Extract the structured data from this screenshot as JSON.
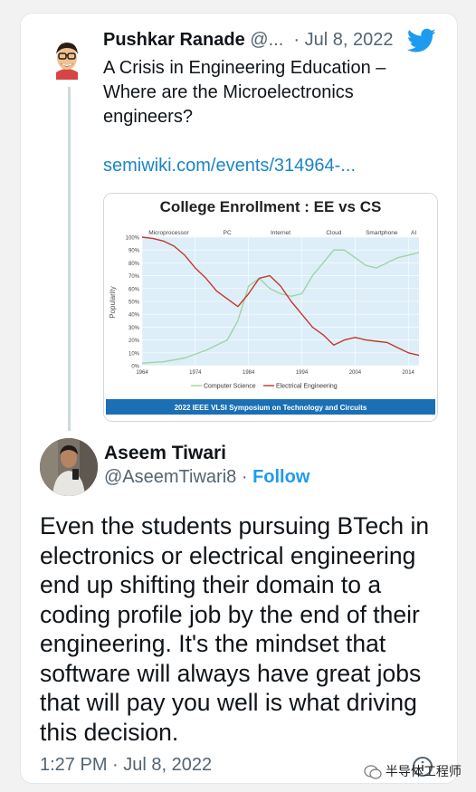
{
  "quoted_tweet": {
    "author_name": "Pushkar Ranade",
    "author_handle": "@...",
    "separator": "·",
    "date": "Jul 8, 2022",
    "text": "A Crisis in Engineering Education – Where are the Microelectronics engineers?",
    "link_text": "semiwiki.com/events/314964-..."
  },
  "chart_data": {
    "type": "line",
    "title": "College Enrollment : EE vs CS",
    "ylabel": "Popularity",
    "footer": "2022 IEEE VLSI Symposium on Technology and Circuits",
    "x_ticks": [
      "1964",
      "1974",
      "1984",
      "1994",
      "2004",
      "2014"
    ],
    "y_ticks": [
      "0%",
      "10%",
      "20%",
      "30%",
      "40%",
      "50%",
      "60%",
      "70%",
      "80%",
      "90%",
      "100%"
    ],
    "ylim": [
      0,
      100
    ],
    "xlim": [
      1964,
      2016
    ],
    "eras": [
      {
        "label": "Microprocessor",
        "x": 1969
      },
      {
        "label": "PC",
        "x": 1980
      },
      {
        "label": "Internet",
        "x": 1990
      },
      {
        "label": "Cloud",
        "x": 2000
      },
      {
        "label": "Smartphone",
        "x": 2009
      },
      {
        "label": "AI",
        "x": 2015
      }
    ],
    "series": [
      {
        "name": "Computer Science",
        "color": "#9fd4a3",
        "x": [
          1964,
          1968,
          1972,
          1976,
          1980,
          1982,
          1984,
          1986,
          1988,
          1990,
          1992,
          1994,
          1996,
          1998,
          2000,
          2002,
          2004,
          2006,
          2008,
          2010,
          2012,
          2014,
          2016
        ],
        "y": [
          2,
          3,
          6,
          12,
          20,
          35,
          62,
          68,
          60,
          56,
          54,
          56,
          70,
          80,
          90,
          90,
          84,
          78,
          76,
          80,
          84,
          86,
          88
        ]
      },
      {
        "name": "Electrical Engineering",
        "color": "#c0392b",
        "x": [
          1964,
          1966,
          1968,
          1970,
          1972,
          1974,
          1976,
          1978,
          1980,
          1982,
          1984,
          1986,
          1988,
          1990,
          1992,
          1994,
          1996,
          1998,
          2000,
          2002,
          2004,
          2006,
          2008,
          2010,
          2012,
          2014,
          2016
        ],
        "y": [
          100,
          99,
          97,
          93,
          86,
          76,
          68,
          58,
          52,
          46,
          56,
          68,
          70,
          62,
          50,
          40,
          30,
          24,
          16,
          20,
          22,
          20,
          19,
          18,
          14,
          10,
          8
        ]
      }
    ]
  },
  "reply": {
    "author_name": "Aseem Tiwari",
    "author_handle": "@AseemTiwari8",
    "separator": "·",
    "follow_label": "Follow",
    "text": "Even the students pursuing BTech in electronics or electrical engineering end up shifting their domain to a coding profile job by the end of their engineering. It's the mindset that software will always have great jobs that will pay you well is what driving this decision.",
    "timestamp": "1:27 PM · Jul 8, 2022"
  },
  "watermark": "半导体工程师",
  "colors": {
    "twitter_blue": "#1d9bf0",
    "link_blue": "#1b84c7",
    "muted": "#536471"
  }
}
